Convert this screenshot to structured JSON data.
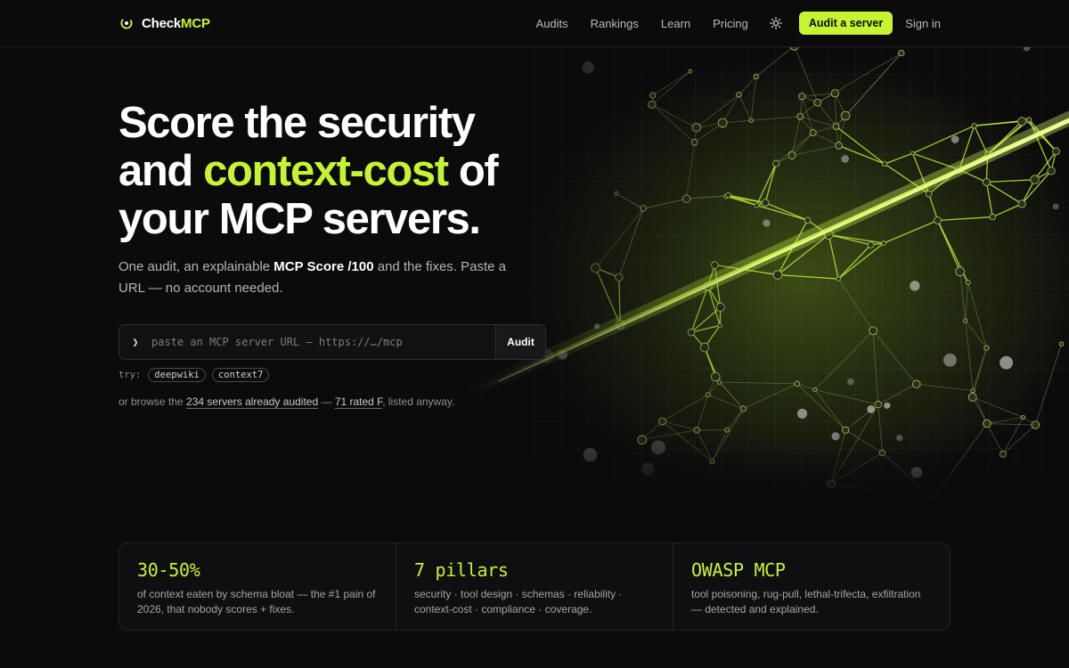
{
  "brand": {
    "name_prefix": "Check",
    "name_accent": "MCP"
  },
  "nav": {
    "links": [
      "Audits",
      "Rankings",
      "Learn",
      "Pricing"
    ],
    "theme_icon": "sun-icon",
    "cta": "Audit a server",
    "signin": "Sign in"
  },
  "hero": {
    "headline_1": "Score the security",
    "headline_2a": "and ",
    "headline_2_accent": "context-cost",
    "headline_2b": " of",
    "headline_3": "your MCP servers.",
    "sub_1": "One audit, an explainable ",
    "sub_bold": "MCP Score /100",
    "sub_2": " and the fixes. Paste a URL — no account needed.",
    "input_prompt": "❯",
    "input_placeholder": "paste an MCP server URL — https://…/mcp",
    "input_value": "",
    "audit_button": "Audit",
    "try_label": "try:",
    "try_chips": [
      "deepwiki",
      "context7"
    ],
    "browse_1": "or browse the ",
    "browse_link_1": "234 servers already audited",
    "browse_2": " — ",
    "browse_link_2": "71 rated F",
    "browse_3": ", listed anyway."
  },
  "stats": [
    {
      "value": "30-50%",
      "desc": "of context eaten by schema bloat — the #1 pain of 2026, that nobody scores + fixes."
    },
    {
      "value": "7 pillars",
      "desc": "security · tool design · schemas · reliability · context-cost · compliance · coverage."
    },
    {
      "value": "OWASP MCP",
      "desc": "tool poisoning, rug-pull, lethal-trifecta, exfiltration — detected and explained."
    }
  ],
  "colors": {
    "accent": "#c6f432",
    "background": "#0b0b0c",
    "text": "#ececec",
    "muted": "#8e8e92"
  }
}
